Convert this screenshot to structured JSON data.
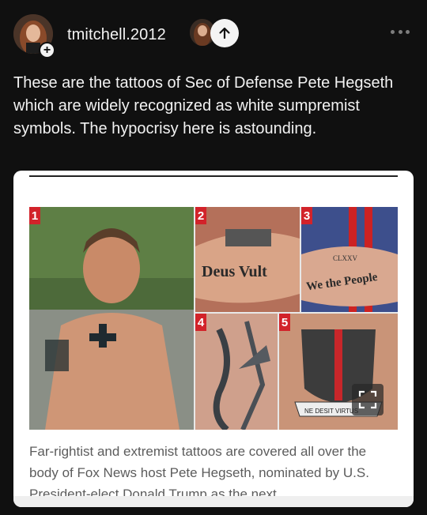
{
  "post": {
    "username": "tmitchell.2012",
    "follow_symbol": "+",
    "text": "These are the tattoos of Sec of Defense Pete Hegseth which are widely recognized as white sumpremist symbols. The hypocrisy here is astounding.",
    "icons": {
      "repost": "arrow-up-icon",
      "more": "more-horizontal-icon",
      "follow": "plus-icon"
    }
  },
  "embed": {
    "panel_numbers": [
      "1",
      "2",
      "3",
      "4",
      "5"
    ],
    "tattoo_texts": [
      "Deus Vult",
      "CLXXV",
      "We the People",
      "NE DESIT VIRTUS"
    ],
    "caption": "Far-rightist and extremist tattoos are covered all over the body of Fox News host Pete Hegseth, nominated by U.S. President-elect Donald Trump as the next",
    "colors": {
      "panel_number_bg": "#d2232a"
    },
    "icons": {
      "expand": "expand-icon"
    }
  }
}
